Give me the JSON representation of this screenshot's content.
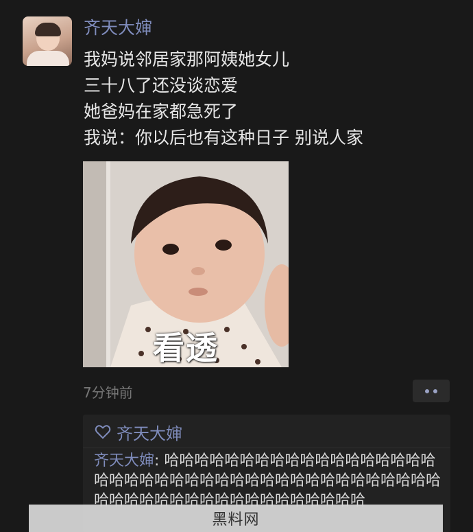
{
  "post": {
    "author": "齐天大婶",
    "avatar_icon": "avatar-photo",
    "text_lines": [
      "我妈说邻居家那阿姨她女儿",
      "三十八了还没谈恋爱",
      "她爸妈在家都急死了",
      "我说：你以后也有这种日子 别说人家"
    ],
    "image": {
      "description_icon": "baby-photo",
      "caption": "看透"
    },
    "timestamp": "7分钟前",
    "more_icon": "more-dots-icon"
  },
  "interactions": {
    "likes": {
      "icon": "heart-outline-icon",
      "names": "齐天大婶"
    },
    "comments": [
      {
        "author": "齐天大婶",
        "separator": ": ",
        "text": "哈哈哈哈哈哈哈哈哈哈哈哈哈哈哈哈哈哈哈哈哈哈哈哈哈哈哈哈哈哈哈哈哈哈哈哈哈哈哈哈哈哈哈哈哈哈哈哈哈哈哈哈哈哈哈哈哈哈哈"
      }
    ]
  },
  "watermark": {
    "text": "黑料网"
  },
  "colors": {
    "background": "#191919",
    "name_link": "#7f8cbc",
    "body_text": "#e6e6e6",
    "timestamp": "#777777",
    "panel": "#222222"
  }
}
